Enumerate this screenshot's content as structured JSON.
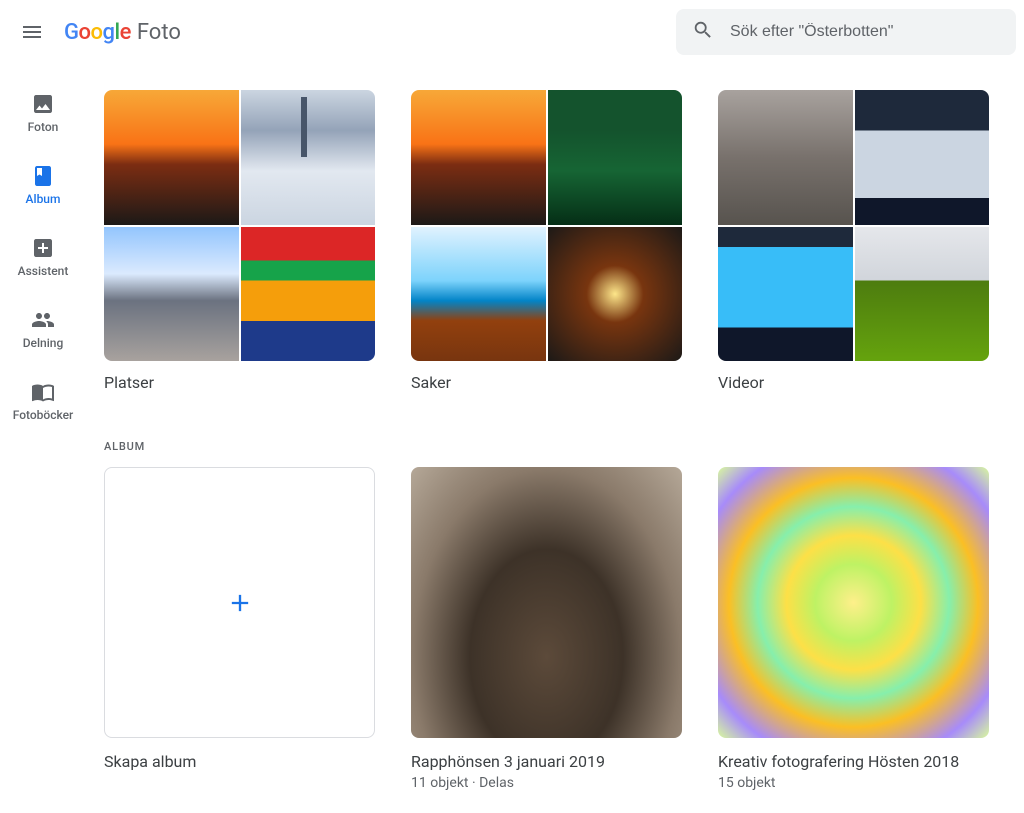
{
  "header": {
    "product_name": "Foto",
    "search_placeholder": "Sök efter \"Österbotten\""
  },
  "sidebar": {
    "items": [
      {
        "label": "Foton"
      },
      {
        "label": "Album"
      },
      {
        "label": "Assistent"
      },
      {
        "label": "Delning"
      },
      {
        "label": "Fotoböcker"
      }
    ]
  },
  "categories": [
    {
      "label": "Platser"
    },
    {
      "label": "Saker"
    },
    {
      "label": "Videor"
    }
  ],
  "album_section_header": "ALBUM",
  "create_album_label": "Skapa album",
  "albums": [
    {
      "title": "Rapphönsen 3 januari 2019",
      "meta": "11 objekt  ·  Delas"
    },
    {
      "title": "Kreativ fotografering Hösten 2018",
      "meta": "15 objekt"
    }
  ]
}
